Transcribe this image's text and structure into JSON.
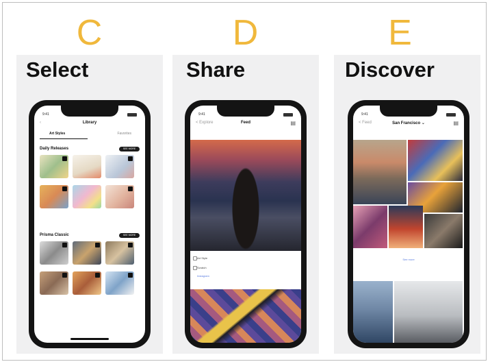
{
  "panels": [
    {
      "letter": "C",
      "heading": "Select"
    },
    {
      "letter": "D",
      "heading": "Share"
    },
    {
      "letter": "E",
      "heading": "Discover"
    }
  ],
  "select_screen": {
    "time": "9:41",
    "title": "Library",
    "tabs": [
      "Art Styles",
      "Favorites"
    ],
    "section_1": "Daily Releases",
    "section_1_btn": "SEE MORE",
    "section_2": "Prisma Classic",
    "section_2_btn": "SEE MORE"
  },
  "share_screen": {
    "time": "9:41",
    "back": "< Explore",
    "title": "Feed",
    "card_lines": [
      "Art Style",
      "Scratch",
      "Instagram"
    ]
  },
  "discover_screen": {
    "time": "9:41",
    "back": "< Feed",
    "title": "San Francisco ⌄",
    "see_more": "See more"
  },
  "colors": {
    "letter": "#f0b83c",
    "panel_bg": "#f0f0f1",
    "phone": "#141414"
  }
}
